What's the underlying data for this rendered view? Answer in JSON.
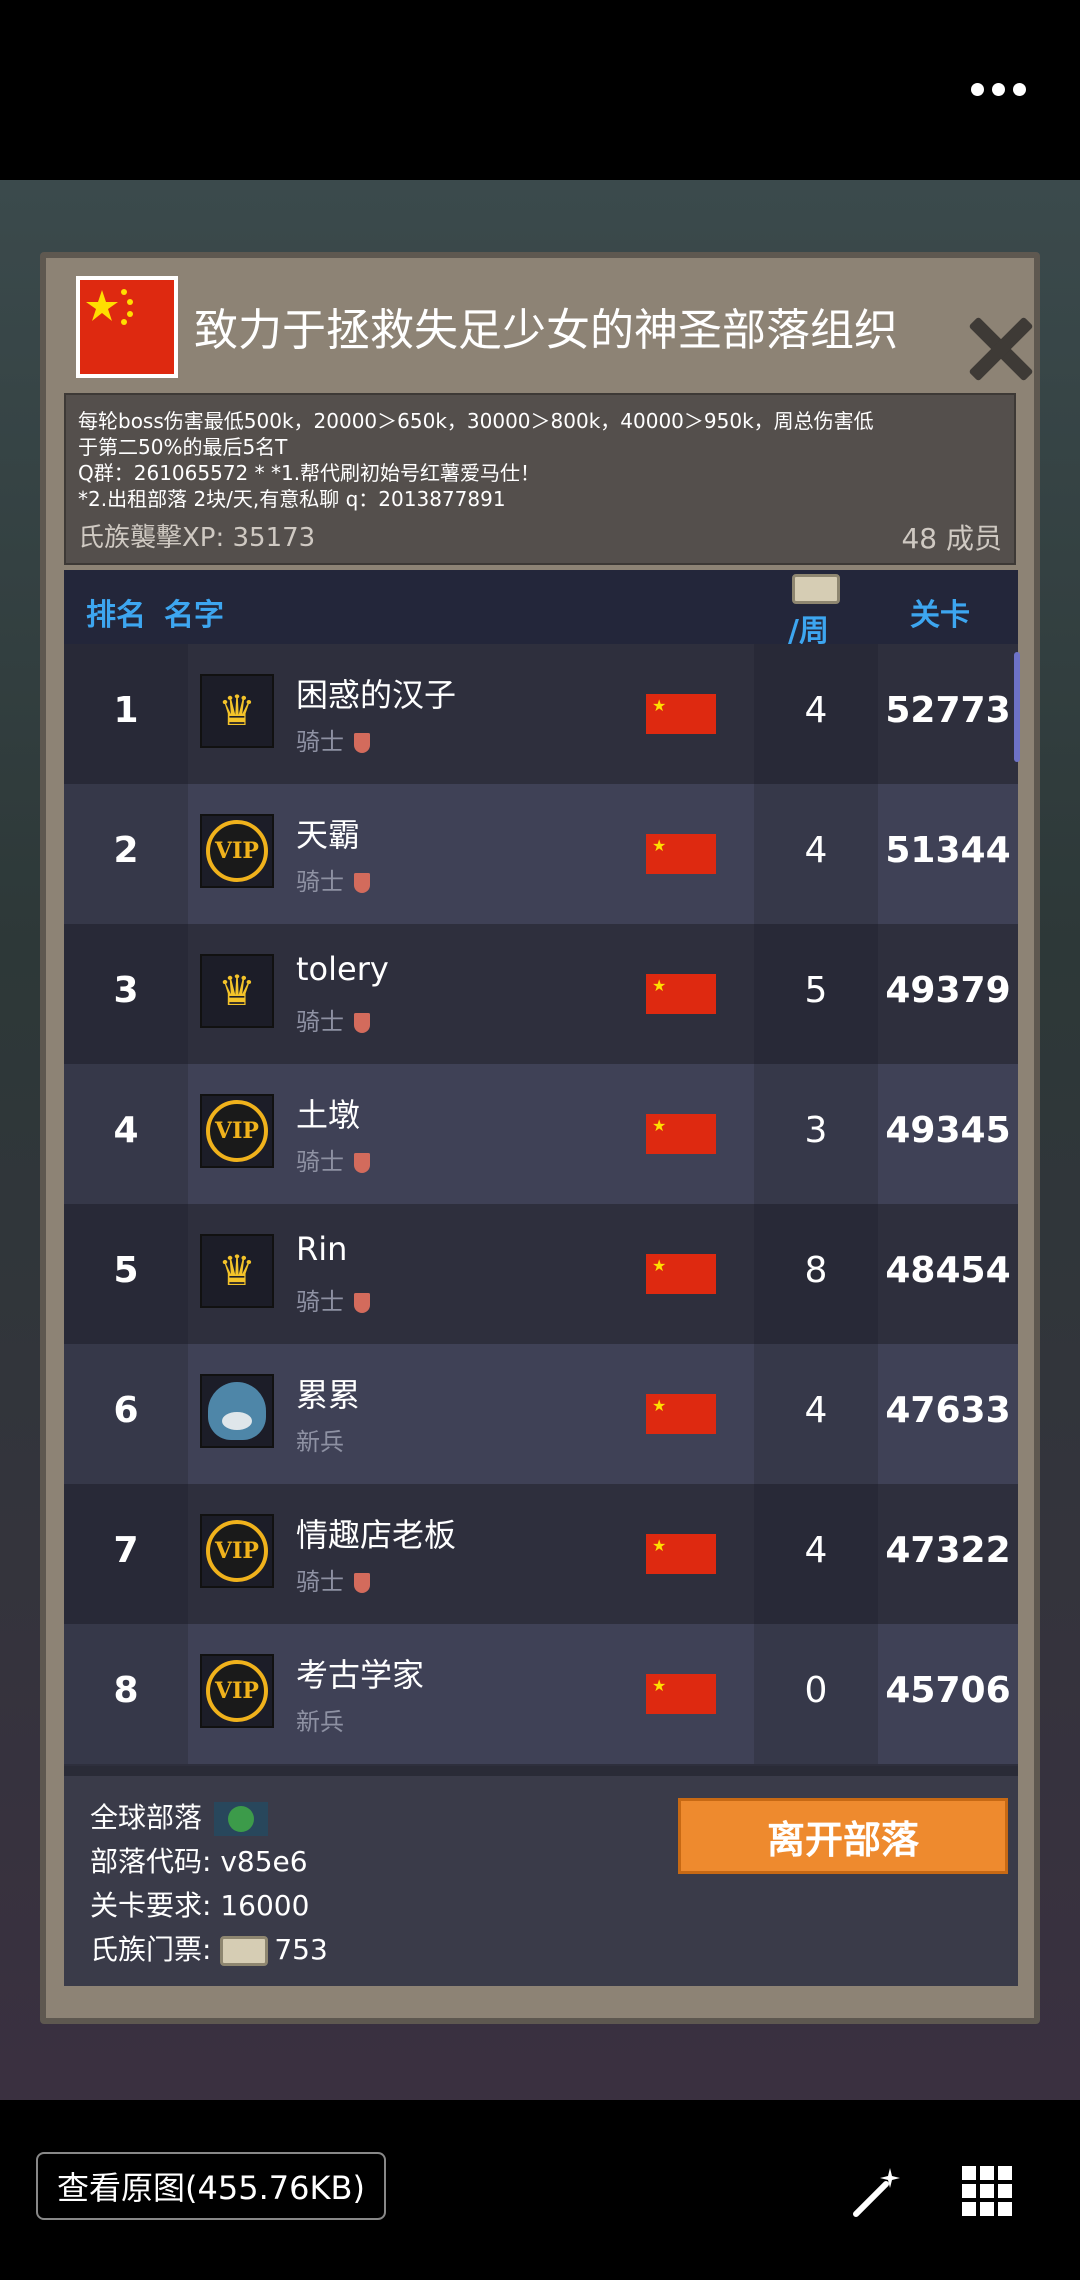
{
  "tribe": {
    "title": "致力于拯救失足少女的神圣部落组织",
    "description": [
      "每轮boss伤害最低500k，20000＞650k，30000＞800k，40000＞950k，周总伤害低",
      "于第二50%的最后5名T",
      "Q群：261065572 * *1.帮代刷初始号红薯爱马仕！",
      "*2.出租部落 2块/天,有意私聊 q：2013877891"
    ],
    "xp_label": "氏族襲擊XP: 35173",
    "members_label": "48 成员"
  },
  "table": {
    "headers": {
      "rank": "排名",
      "name": "名字",
      "week": "/周",
      "level": "关卡"
    },
    "rows": [
      {
        "rank": "1",
        "avatar": "crown",
        "name": "困惑的汉子",
        "role": "骑士",
        "shield": true,
        "week": "4",
        "level": "52773"
      },
      {
        "rank": "2",
        "avatar": "vip",
        "name": "天霸",
        "role": "骑士",
        "shield": true,
        "week": "4",
        "level": "51344"
      },
      {
        "rank": "3",
        "avatar": "crown",
        "name": "tolery",
        "role": "骑士",
        "shield": true,
        "week": "5",
        "level": "49379"
      },
      {
        "rank": "4",
        "avatar": "vip",
        "name": "土墩",
        "role": "骑士",
        "shield": true,
        "week": "3",
        "level": "49345"
      },
      {
        "rank": "5",
        "avatar": "crown",
        "name": "Rin",
        "role": "骑士",
        "shield": true,
        "week": "8",
        "level": "48454"
      },
      {
        "rank": "6",
        "avatar": "mascot",
        "name": "累累",
        "role": "新兵",
        "shield": false,
        "week": "4",
        "level": "47633"
      },
      {
        "rank": "7",
        "avatar": "vip",
        "name": "情趣店老板",
        "role": "骑士",
        "shield": true,
        "week": "4",
        "level": "47322"
      },
      {
        "rank": "8",
        "avatar": "vip",
        "name": "考古学家",
        "role": "新兵",
        "shield": false,
        "week": "0",
        "level": "45706"
      }
    ]
  },
  "footer": {
    "global_label": "全球部落",
    "code_label": "部落代码: v85e6",
    "req_label": "关卡要求:  16000",
    "ticket_label": "氏族门票:",
    "ticket_value": "753",
    "leave_button": "离开部落"
  },
  "vip_text": "VIP",
  "viewer": {
    "view_original": "查看原图(455.76KB)"
  },
  "colors": {
    "accent_blue": "#3da6f0",
    "leave_orange": "#ee8a2e",
    "flag_red": "#de2910"
  }
}
